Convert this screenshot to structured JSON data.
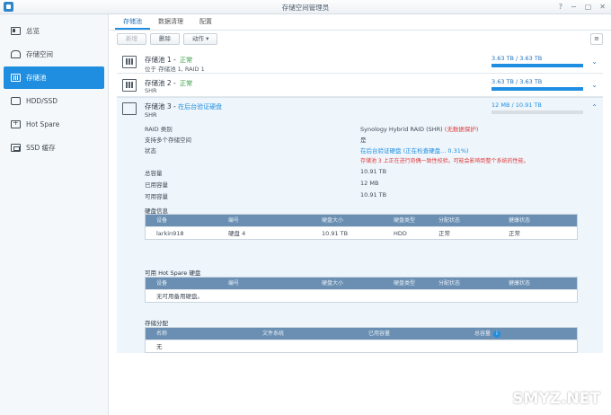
{
  "window": {
    "title": "存储空间管理员",
    "help": "?",
    "minimize": "−",
    "maximize": "▢",
    "close": "✕"
  },
  "sidebar": {
    "items": [
      {
        "label": "总览",
        "icon": "overview-icon"
      },
      {
        "label": "存储空间",
        "icon": "volume-icon"
      },
      {
        "label": "存储池",
        "icon": "storage-pool-icon"
      },
      {
        "label": "HDD/SSD",
        "icon": "hdd-icon"
      },
      {
        "label": "Hot Spare",
        "icon": "hot-spare-icon"
      },
      {
        "label": "SSD 缓存",
        "icon": "ssd-cache-icon"
      }
    ]
  },
  "tabs": [
    "存储池",
    "数据清理",
    "配置"
  ],
  "toolbar": {
    "create": "新增",
    "delete": "删除",
    "action": "动作 ▾",
    "view_toggle": "≡"
  },
  "pools": [
    {
      "name": "存储池 1",
      "status": "正常",
      "sub": "位于 存储池 1, RAID 1",
      "capacity": "3.63 TB / 3.63 TB",
      "usage": 1.0
    },
    {
      "name": "存储池 2",
      "status": "正常",
      "sub": "SHR",
      "capacity": "3.63 TB / 3.63 TB",
      "usage": 1.0
    },
    {
      "name": "存储池 3",
      "status": "在后台验证硬盘",
      "sub": "SHR",
      "capacity": "12 MB / 10.91 TB",
      "usage": 0.0
    }
  ],
  "details": {
    "raid_type_label": "RAID 类别",
    "raid_type_value": "Synology Hybrid RAID (SHR)",
    "raid_type_note": "(无数据保护)",
    "multi_volume_label": "支持多个存储空间",
    "multi_volume_value": "是",
    "status_label": "状态",
    "status_value": "在后台验证硬盘 (正在检查硬盘... 0.31%)",
    "status_warning": "存储池 3 上正在进行奇偶一致性校验。可能会影响到整个系统的性能。",
    "total_label": "总容量",
    "total_value": "10.91 TB",
    "used_label": "已用容量",
    "used_value": "12 MB",
    "avail_label": "可用容量",
    "avail_value": "10.91 TB"
  },
  "disk_info": {
    "title": "硬盘信息",
    "headers": [
      "设备",
      "编号",
      "硬盘大小",
      "硬盘类型",
      "分配状态",
      "健康状态"
    ],
    "rows": [
      [
        "larkin918",
        "硬盘 4",
        "10.91 TB",
        "HDD",
        "正常",
        "正常"
      ]
    ]
  },
  "hot_spare": {
    "title": "可用 Hot Spare 硬盘",
    "headers": [
      "设备",
      "编号",
      "硬盘大小",
      "硬盘类型",
      "分配状态",
      "健康状态"
    ],
    "empty": "无可用备用硬盘。"
  },
  "allocation": {
    "title": "存储分配",
    "headers": [
      "名称",
      "文件系统",
      "已用容量",
      "总容量"
    ],
    "empty": "无"
  },
  "watermark": "SMYZ.NET",
  "colors": {
    "accent": "#1f8ee0",
    "ok": "#2d9b3c",
    "warning": "#e03b3b"
  }
}
